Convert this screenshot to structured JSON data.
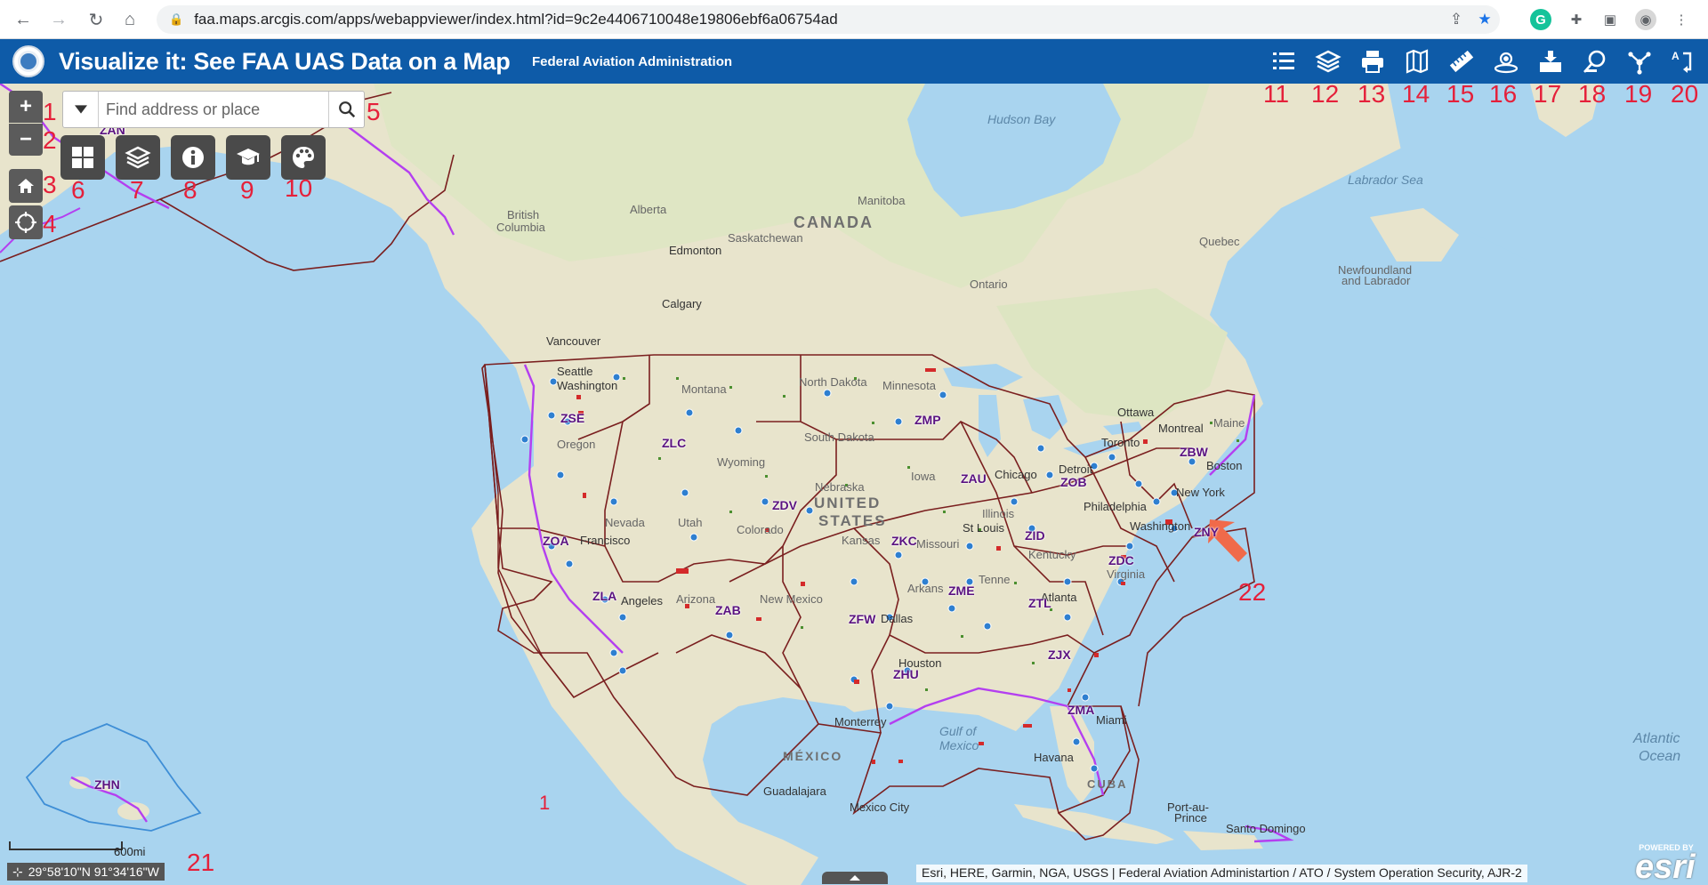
{
  "browser": {
    "url": "faa.maps.arcgis.com/apps/webappviewer/index.html?id=9c2e4406710048e19806ebf6a06754ad",
    "icons": [
      "back-icon",
      "forward-icon",
      "reload-icon",
      "home-icon",
      "lock-icon",
      "share-icon",
      "star-icon",
      "grammarly-icon",
      "extensions-icon",
      "sidepanel-icon",
      "profile-icon",
      "menu-icon"
    ]
  },
  "header": {
    "title": "Visualize it: See FAA UAS Data on a Map",
    "subtitle": "Federal Aviation Administration",
    "tools": [
      {
        "icon": "legend-icon",
        "number": "11"
      },
      {
        "icon": "layers-icon",
        "number": "12"
      },
      {
        "icon": "print-icon",
        "number": "13"
      },
      {
        "icon": "basemap-gallery-icon",
        "number": "14"
      },
      {
        "icon": "measurement-icon",
        "number": "15"
      },
      {
        "icon": "near-me-icon",
        "number": "16"
      },
      {
        "icon": "add-data-icon",
        "number": "17"
      },
      {
        "icon": "query-icon",
        "number": "18"
      },
      {
        "icon": "share-icon",
        "number": "19"
      },
      {
        "icon": "about-icon",
        "number": "20"
      }
    ]
  },
  "controls": {
    "zoom_in": "+",
    "zoom_out": "−",
    "numbers": {
      "zoom_in": "1",
      "zoom_out": "2",
      "home": "3",
      "locate": "4",
      "search": "5",
      "widget1": "6",
      "widget2": "7",
      "widget3": "8",
      "widget4": "9",
      "widget5": "10",
      "scale": "21",
      "arrow": "22",
      "map_center": "1"
    }
  },
  "search": {
    "placeholder": "Find address or place"
  },
  "widgets": [
    {
      "icon": "launchpad-icon"
    },
    {
      "icon": "layer-list-icon"
    },
    {
      "icon": "info-icon"
    },
    {
      "icon": "education-icon"
    },
    {
      "icon": "basemap-icon"
    }
  ],
  "map": {
    "oceans": {
      "hudson_bay": "Hudson Bay",
      "labrador_sea": "Labrador Sea",
      "gulf_of_mexico_1": "Gulf of",
      "gulf_of_mexico_2": "Mexico",
      "atlantic_1": "Atlantic",
      "atlantic_2": "Ocean"
    },
    "countries": {
      "canada": "CANADA",
      "united": "UNITED",
      "states": "STATES",
      "mexico": "MÉXICO",
      "cuba": "CUBA"
    },
    "regions": {
      "british_1": "British",
      "british_2": "Columbia",
      "alberta": "Alberta",
      "manitoba": "Manitoba",
      "saskatchewan": "Saskatchewan",
      "ontario": "Ontario",
      "quebec": "Quebec",
      "newfoundland_1": "Newfoundland",
      "newfoundland_2": "and Labrador",
      "montana": "Montana",
      "north_dakota": "North Dakota",
      "minnesota": "Minnesota",
      "south_dakota": "South Dakota",
      "oregon": "Oregon",
      "nevada": "Nevada",
      "utah": "Utah",
      "nebraska": "Nebraska",
      "iowa": "Iowa",
      "kansas": "Kansas",
      "arizona": "Arizona",
      "new_mexico": "New Mexico",
      "wyoming": "Wyoming",
      "colorado": "Colorado",
      "maine": "Maine",
      "kentucky": "Kentucky",
      "tennessee": "Tenne",
      "arkansas": "Arkans",
      "missouri": "Missouri",
      "virginia": "Virginia",
      "illinois": "Illinois"
    },
    "cities": {
      "edmonton": "Edmonton",
      "calgary": "Calgary",
      "vancouver": "Vancouver",
      "seattle": "Seattle",
      "ottawa": "Ottawa",
      "montreal": "Montreal",
      "toronto": "Toronto",
      "boston": "Boston",
      "new_york": "New York",
      "detroit": "Detroit",
      "chicago": "Chicago",
      "philadelphia": "Philadelphia",
      "washington": "Washington",
      "st_louis": "St Louis",
      "dallas": "Dallas",
      "houston": "Houston",
      "miami": "Miami",
      "atlanta": "Atlanta",
      "san_francisco": "Francisco",
      "los_angeles": "Angeles",
      "monterrey": "Monterrey",
      "guadalajara": "Guadalajara",
      "mexico_city": "Mexico City",
      "havana": "Havana",
      "port_au_prince_1": "Port-au-",
      "port_au_prince_2": "Prince",
      "santo_domingo": "Santo Domingo",
      "washington_state": "Washington"
    },
    "artcc": [
      "ZSE",
      "ZLC",
      "ZMP",
      "ZAU",
      "ZOB",
      "ZBW",
      "ZDV",
      "ZKC",
      "ZID",
      "ZNY",
      "ZOA",
      "ZLA",
      "ZAB",
      "ZFW",
      "ZME",
      "ZTL",
      "ZDC",
      "ZJX",
      "ZHU",
      "ZMA",
      "ZHN",
      "ZAN"
    ]
  },
  "footer": {
    "coordinates": "29°58'10\"N 91°34'16\"W",
    "scale_label": "600mi",
    "attribution": "Esri, HERE, Garmin, NGA, USGS | Federal Aviation Administartion / ATO / System Operation Security, AJR-2",
    "powered_by": "POWERED BY",
    "esri": "esri"
  },
  "colors": {
    "header": "#0e5ba8",
    "land": "#e8e4cc",
    "water": "#a9d4ef",
    "artcc_boundary": "#7a1f1f",
    "coast_boundary": "#b43ff0",
    "annotation": "#e5203a"
  }
}
